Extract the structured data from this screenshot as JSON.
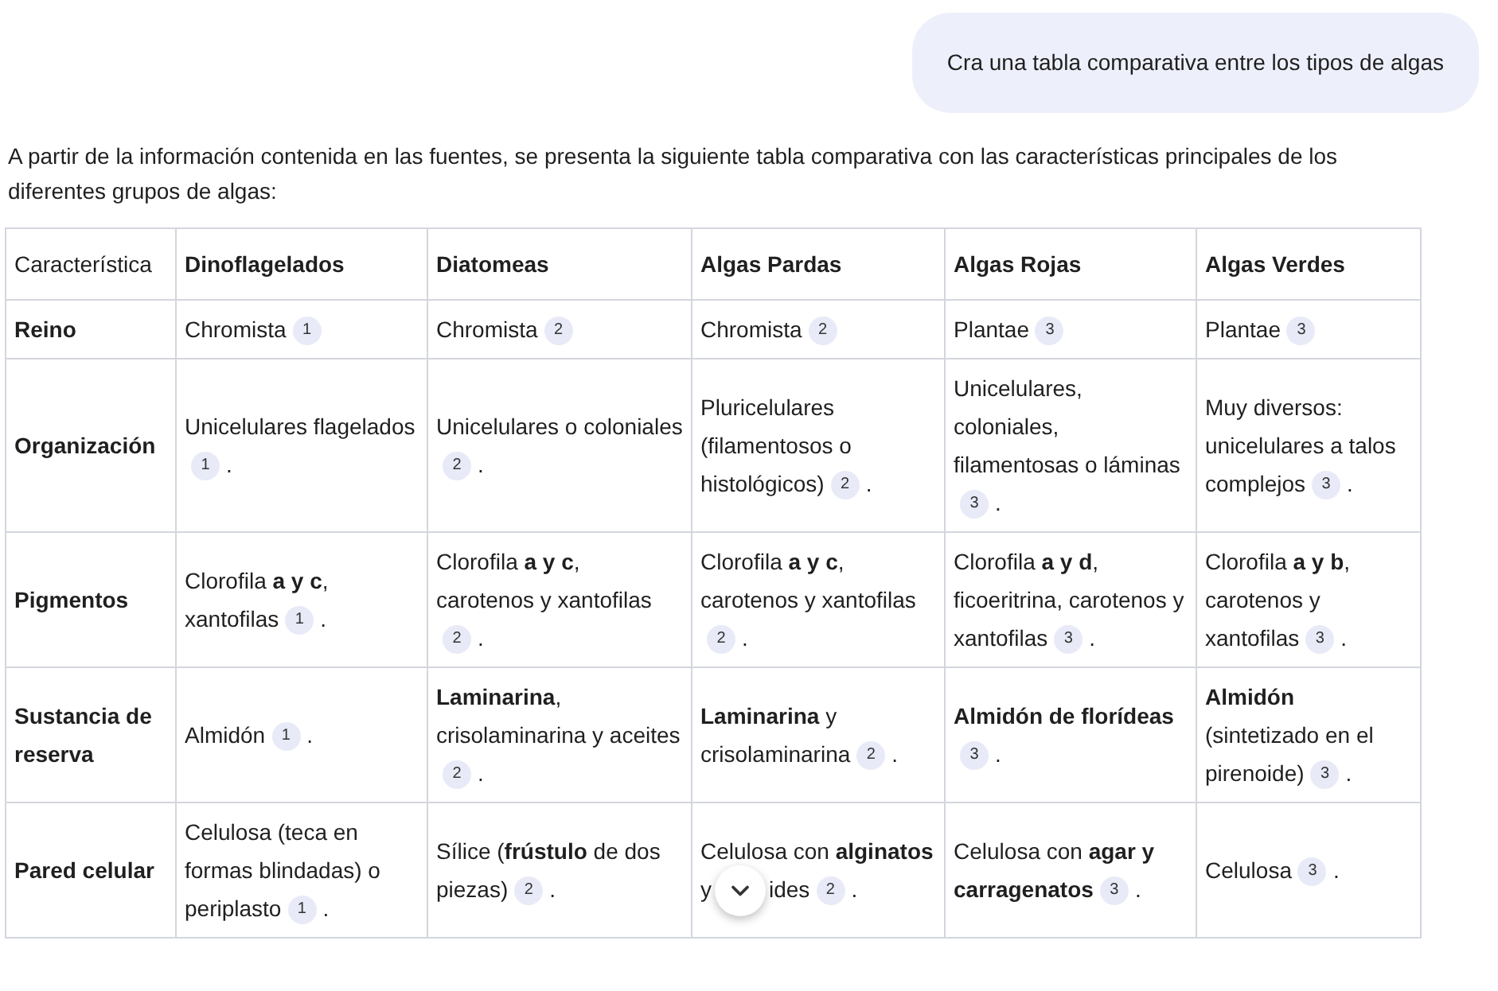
{
  "user_message": "Cra una tabla comparativa entre los tipos de algas",
  "intro": "A partir de la información contenida en las fuentes, se presenta la siguiente tabla comparativa con las características principales de los diferentes grupos de algas:",
  "table": {
    "columns": [
      "Característica",
      "Dinoflagelados",
      "Diatomeas",
      "Algas Pardas",
      "Algas Rojas",
      "Algas Verdes"
    ],
    "rows": [
      {
        "cells": [
          [
            {
              "kind": "label",
              "text": "Reino"
            }
          ],
          [
            {
              "kind": "text",
              "text": "Chromista"
            },
            {
              "kind": "cite",
              "text": "1"
            }
          ],
          [
            {
              "kind": "text",
              "text": "Chromista"
            },
            {
              "kind": "cite",
              "text": "2"
            }
          ],
          [
            {
              "kind": "text",
              "text": "Chromista"
            },
            {
              "kind": "cite",
              "text": "2"
            }
          ],
          [
            {
              "kind": "text",
              "text": "Plantae"
            },
            {
              "kind": "cite",
              "text": "3"
            }
          ],
          [
            {
              "kind": "text",
              "text": "Plantae"
            },
            {
              "kind": "cite",
              "text": "3"
            }
          ]
        ]
      },
      {
        "cells": [
          [
            {
              "kind": "label",
              "text": "Organización"
            }
          ],
          [
            {
              "kind": "text",
              "text": "Unicelulares flagelados"
            },
            {
              "kind": "cite",
              "text": "1"
            },
            {
              "kind": "text",
              "text": "."
            }
          ],
          [
            {
              "kind": "text",
              "text": "Unicelulares o coloniales"
            },
            {
              "kind": "cite",
              "text": "2"
            },
            {
              "kind": "text",
              "text": "."
            }
          ],
          [
            {
              "kind": "text",
              "text": "Pluricelulares (filamentosos o histológicos)"
            },
            {
              "kind": "cite",
              "text": "2"
            },
            {
              "kind": "text",
              "text": "."
            }
          ],
          [
            {
              "kind": "text",
              "text": "Unicelulares, coloniales, filamentosas o láminas"
            },
            {
              "kind": "cite",
              "text": "3"
            },
            {
              "kind": "text",
              "text": "."
            }
          ],
          [
            {
              "kind": "text",
              "text": "Muy diversos: unicelulares a talos complejos"
            },
            {
              "kind": "cite",
              "text": "3"
            },
            {
              "kind": "text",
              "text": "."
            }
          ]
        ]
      },
      {
        "cells": [
          [
            {
              "kind": "label",
              "text": "Pigmentos"
            }
          ],
          [
            {
              "kind": "text",
              "text": "Clorofila **a y c**, xantofilas"
            },
            {
              "kind": "cite",
              "text": "1"
            },
            {
              "kind": "text",
              "text": "."
            }
          ],
          [
            {
              "kind": "text",
              "text": "Clorofila **a y c**, carotenos y xantofilas"
            },
            {
              "kind": "cite",
              "text": "2"
            },
            {
              "kind": "text",
              "text": "."
            }
          ],
          [
            {
              "kind": "text",
              "text": "Clorofila **a y c**, carotenos y xantofilas"
            },
            {
              "kind": "cite",
              "text": "2"
            },
            {
              "kind": "text",
              "text": "."
            }
          ],
          [
            {
              "kind": "text",
              "text": "Clorofila **a y d**, ficoeritrina, carotenos y xantofilas"
            },
            {
              "kind": "cite",
              "text": "3"
            },
            {
              "kind": "text",
              "text": "."
            }
          ],
          [
            {
              "kind": "text",
              "text": "Clorofila **a y b**, carotenos y xantofilas"
            },
            {
              "kind": "cite",
              "text": "3"
            },
            {
              "kind": "text",
              "text": "."
            }
          ]
        ]
      },
      {
        "cells": [
          [
            {
              "kind": "label",
              "text": "Sustancia de reserva"
            }
          ],
          [
            {
              "kind": "text",
              "text": "Almidón"
            },
            {
              "kind": "cite",
              "text": "1"
            },
            {
              "kind": "text",
              "text": "."
            }
          ],
          [
            {
              "kind": "text",
              "text": "**Laminarina**, crisolaminarina y aceites"
            },
            {
              "kind": "cite",
              "text": "2"
            },
            {
              "kind": "text",
              "text": "."
            }
          ],
          [
            {
              "kind": "text",
              "text": "**Laminarina** y crisolaminarina"
            },
            {
              "kind": "cite",
              "text": "2"
            },
            {
              "kind": "text",
              "text": "."
            }
          ],
          [
            {
              "kind": "text",
              "text": "**Almidón de florídeas**"
            },
            {
              "kind": "cite",
              "text": "3"
            },
            {
              "kind": "text",
              "text": "."
            }
          ],
          [
            {
              "kind": "text",
              "text": "**Almidón** (sintetizado en el pirenoide)"
            },
            {
              "kind": "cite",
              "text": "3"
            },
            {
              "kind": "text",
              "text": "."
            }
          ]
        ]
      },
      {
        "cells": [
          [
            {
              "kind": "label",
              "text": "Pared celular"
            }
          ],
          [
            {
              "kind": "text",
              "text": "Celulosa (teca en formas blindadas) o periplasto"
            },
            {
              "kind": "cite",
              "text": "1"
            },
            {
              "kind": "text",
              "text": "."
            }
          ],
          [
            {
              "kind": "text",
              "text": "Sílice (**frústulo** de dos piezas)"
            },
            {
              "kind": "cite",
              "text": "2"
            },
            {
              "kind": "text",
              "text": "."
            }
          ],
          [
            {
              "kind": "text",
              "text": "Celulosa con **alginatos** y"
            },
            {
              "kind": "scroll_down"
            },
            {
              "kind": "text",
              "text": "ides"
            },
            {
              "kind": "cite",
              "text": "2"
            },
            {
              "kind": "text",
              "text": "."
            }
          ],
          [
            {
              "kind": "text",
              "text": "Celulosa con **agar y carragenatos**"
            },
            {
              "kind": "cite",
              "text": "3"
            },
            {
              "kind": "text",
              "text": "."
            }
          ],
          [
            {
              "kind": "text",
              "text": "Celulosa"
            },
            {
              "kind": "cite",
              "text": "3"
            },
            {
              "kind": "text",
              "text": "."
            }
          ]
        ]
      }
    ]
  }
}
